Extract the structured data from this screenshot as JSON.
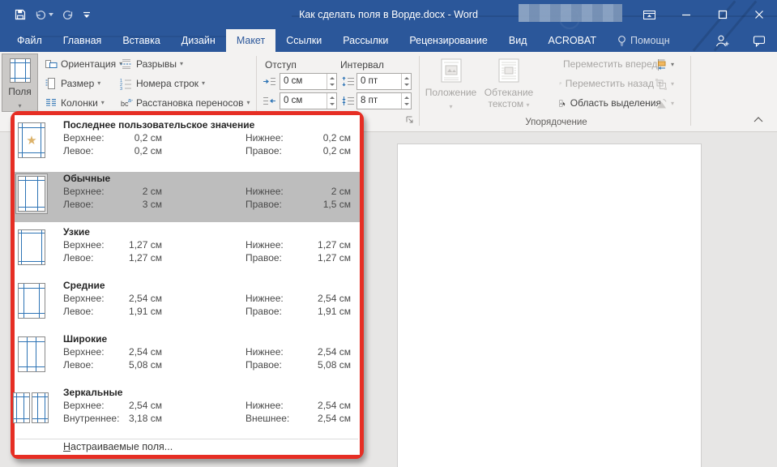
{
  "titlebar": {
    "title": "Как сделать поля в Ворде.docx - Word"
  },
  "icons": {
    "dropdown": "▾",
    "star": "★"
  },
  "colors": {
    "titlebar_blue": "#2b579a",
    "annotation_red": "#e62e24",
    "selected_row": "#bdbdbd",
    "icon_blue": "#2e74b5",
    "star_gold": "#dcb26a"
  },
  "tabs": [
    {
      "label": "Файл"
    },
    {
      "label": "Главная"
    },
    {
      "label": "Вставка"
    },
    {
      "label": "Дизайн"
    },
    {
      "label": "Макет"
    },
    {
      "label": "Ссылки"
    },
    {
      "label": "Рассылки"
    },
    {
      "label": "Рецензирование"
    },
    {
      "label": "Вид"
    },
    {
      "label": "ACROBAT"
    },
    {
      "label": "Помощн"
    }
  ],
  "ribbon": {
    "margins_button": {
      "label": "Поля"
    },
    "page_setup_buttons": [
      {
        "label": "Ориентация"
      },
      {
        "label": "Размер"
      },
      {
        "label": "Колонки"
      },
      {
        "label": "Разрывы"
      },
      {
        "label": "Номера строк"
      },
      {
        "label": "Расстановка переносов"
      }
    ],
    "paragraph": {
      "indent_label": "Отступ",
      "spacing_label": "Интервал",
      "indent_left": "0 см",
      "indent_right": "0 см",
      "spacing_before": "0 пт",
      "spacing_after": "8 пт"
    },
    "arrange": {
      "position_label": "Положение",
      "wrap_line1": "Обтекание",
      "wrap_line2": "текстом",
      "bring_forward": "Переместить вперед",
      "send_backward": "Переместить назад",
      "selection_pane": "Область выделения",
      "group_label": "Упорядочение"
    }
  },
  "margins_menu": {
    "items": [
      {
        "title": "Последнее пользовательское значение",
        "cells": [
          {
            "l": "Верхнее:",
            "v": "0,2 см"
          },
          {
            "l": "Нижнее:",
            "v": "0,2 см"
          },
          {
            "l": "Левое:",
            "v": "0,2 см"
          },
          {
            "l": "Правое:",
            "v": "0,2 см"
          }
        ]
      },
      {
        "title": "Обычные",
        "cells": [
          {
            "l": "Верхнее:",
            "v": "2 см"
          },
          {
            "l": "Нижнее:",
            "v": "2 см"
          },
          {
            "l": "Левое:",
            "v": "3 см"
          },
          {
            "l": "Правое:",
            "v": "1,5 см"
          }
        ]
      },
      {
        "title": "Узкие",
        "cells": [
          {
            "l": "Верхнее:",
            "v": "1,27 см"
          },
          {
            "l": "Нижнее:",
            "v": "1,27 см"
          },
          {
            "l": "Левое:",
            "v": "1,27 см"
          },
          {
            "l": "Правое:",
            "v": "1,27 см"
          }
        ]
      },
      {
        "title": "Средние",
        "cells": [
          {
            "l": "Верхнее:",
            "v": "2,54 см"
          },
          {
            "l": "Нижнее:",
            "v": "2,54 см"
          },
          {
            "l": "Левое:",
            "v": "1,91 см"
          },
          {
            "l": "Правое:",
            "v": "1,91 см"
          }
        ]
      },
      {
        "title": "Широкие",
        "cells": [
          {
            "l": "Верхнее:",
            "v": "2,54 см"
          },
          {
            "l": "Нижнее:",
            "v": "2,54 см"
          },
          {
            "l": "Левое:",
            "v": "5,08 см"
          },
          {
            "l": "Правое:",
            "v": "5,08 см"
          }
        ]
      },
      {
        "title": "Зеркальные",
        "cells": [
          {
            "l": "Верхнее:",
            "v": "2,54 см"
          },
          {
            "l": "Нижнее:",
            "v": "2,54 см"
          },
          {
            "l": "Внутреннее:",
            "v": "3,18 см"
          },
          {
            "l": "Внешнее:",
            "v": "2,54 см"
          }
        ]
      }
    ],
    "footer_accel": "Н",
    "footer_rest": "астраиваемые поля..."
  }
}
